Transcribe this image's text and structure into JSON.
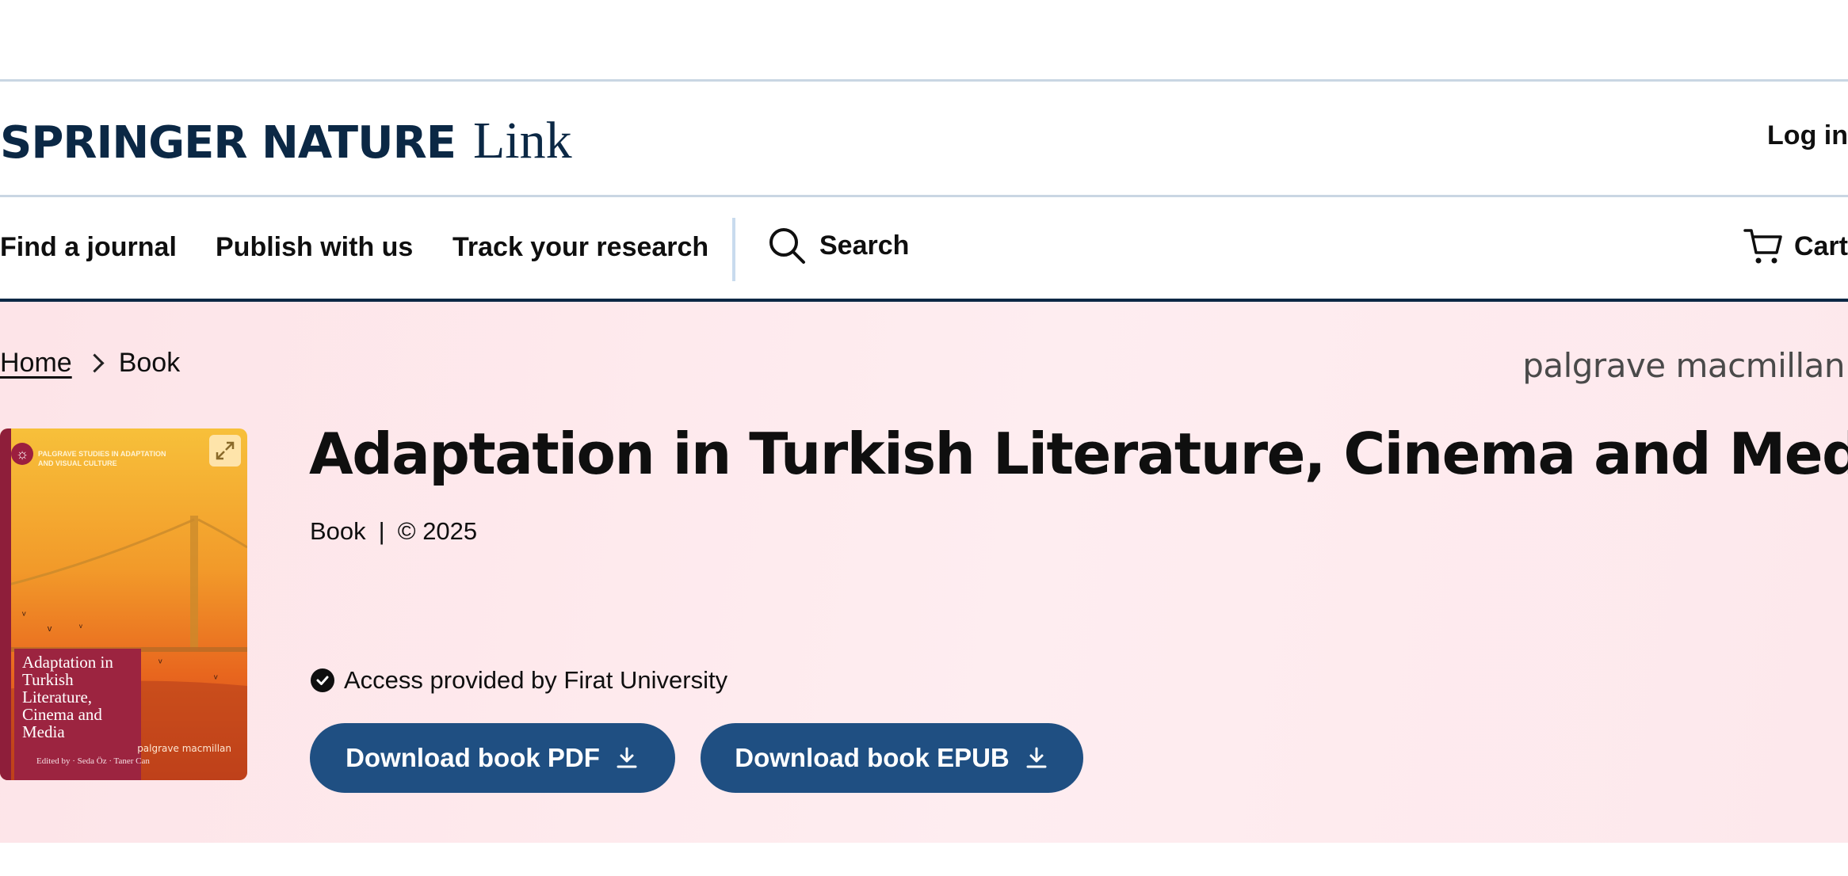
{
  "header": {
    "logo_brand": "SPRINGER NATURE",
    "logo_link": "Link",
    "login_label": "Log in"
  },
  "nav": {
    "items": [
      {
        "label": "Find a journal"
      },
      {
        "label": "Publish with us"
      },
      {
        "label": "Track your research"
      }
    ],
    "search_label": "Search",
    "cart_label": "Cart"
  },
  "breadcrumb": {
    "home": "Home",
    "current": "Book"
  },
  "publisher": "palgrave macmillan",
  "book": {
    "title": "Adaptation in Turkish Literature, Cinema and Media",
    "type": "Book",
    "separator": "|",
    "copyright": "© 2025",
    "access_text": "Access provided by Firat University",
    "cover": {
      "series": "PALGRAVE STUDIES IN ADAPTATION AND VISUAL CULTURE",
      "title": "Adaptation in Turkish Literature, Cinema and Media",
      "editors": "Edited by · Seda Öz · Taner Can",
      "publisher_mark": "palgrave macmillan"
    }
  },
  "buttons": {
    "pdf_label": "Download book PDF",
    "epub_label": "Download book EPUB"
  },
  "colors": {
    "brand_navy": "#0b2845",
    "button_blue": "#1f4f82",
    "hero_pink": "#fde4e8"
  }
}
